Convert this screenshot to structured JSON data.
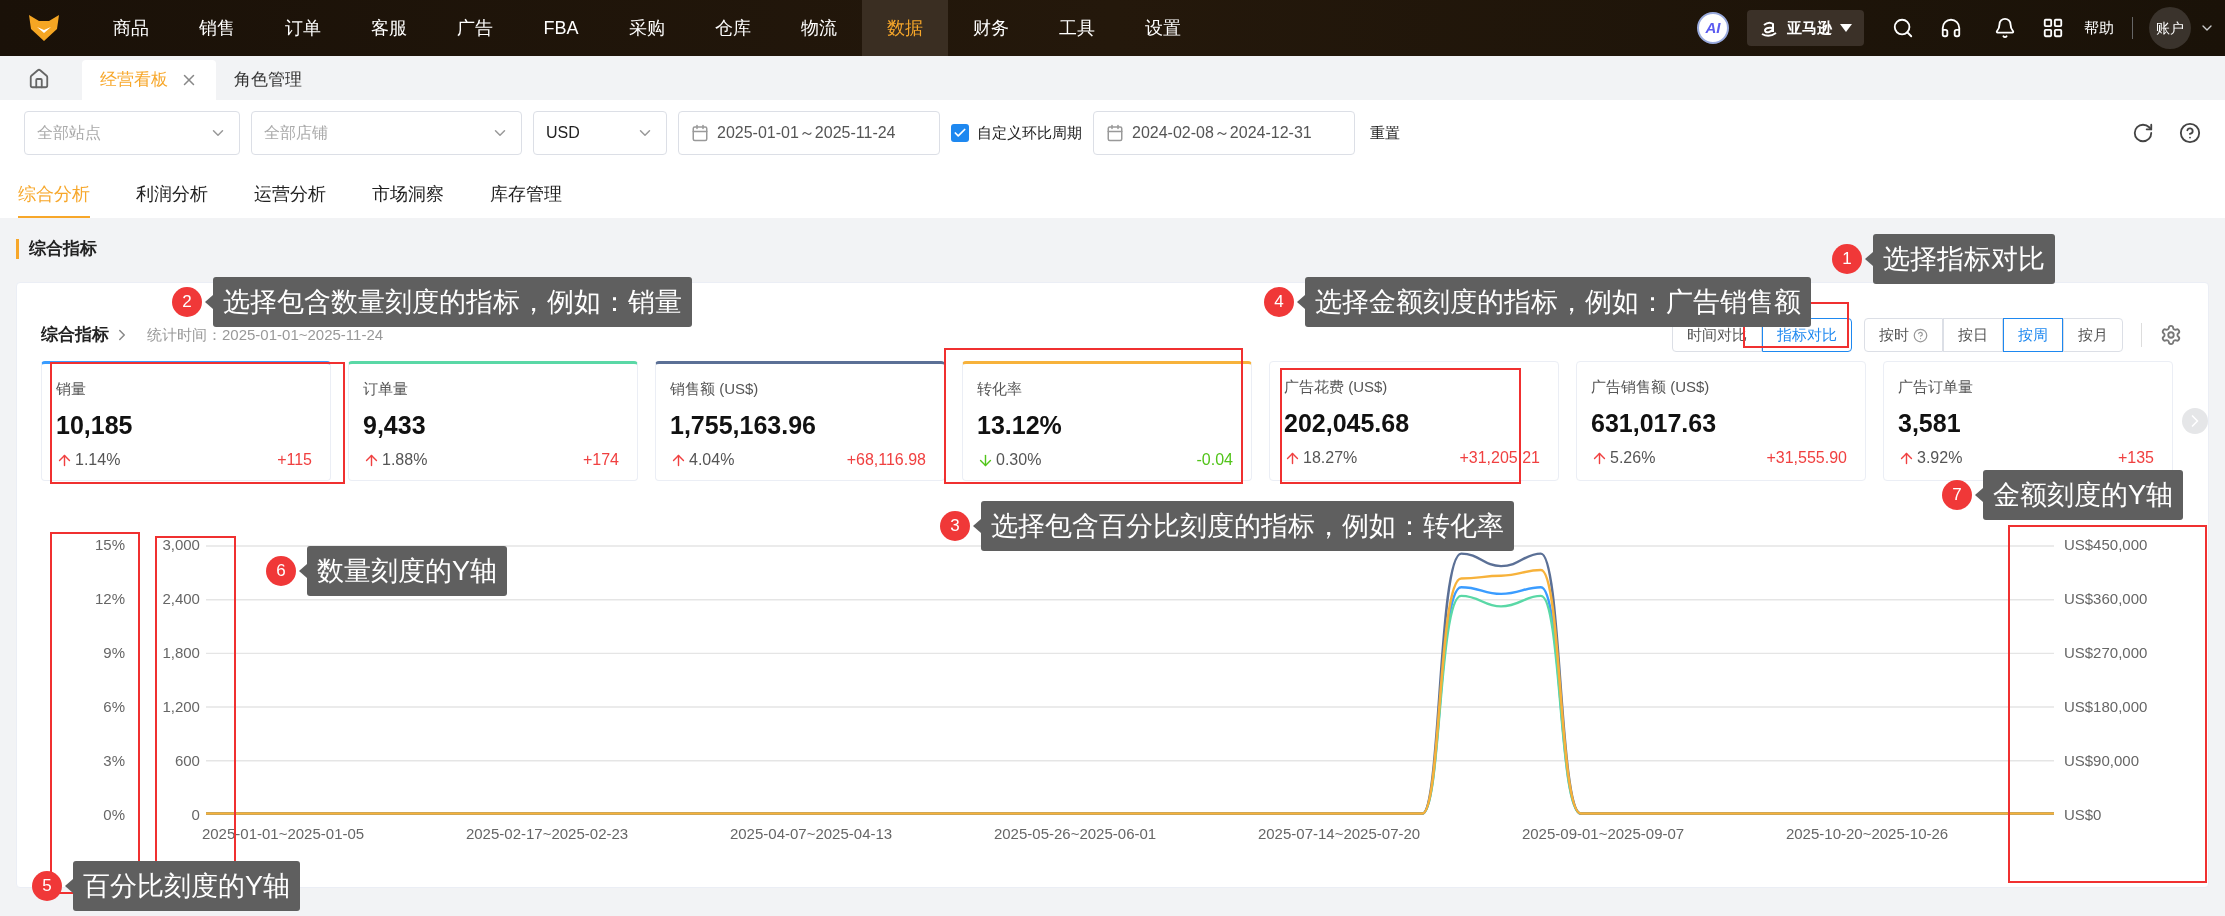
{
  "nav": {
    "items": [
      {
        "label": "商品",
        "selected": false
      },
      {
        "label": "销售",
        "selected": false
      },
      {
        "label": "订单",
        "selected": false
      },
      {
        "label": "客服",
        "selected": false
      },
      {
        "label": "广告",
        "selected": false
      },
      {
        "label": "FBA",
        "selected": false
      },
      {
        "label": "采购",
        "selected": false
      },
      {
        "label": "仓库",
        "selected": false
      },
      {
        "label": "物流",
        "selected": false
      },
      {
        "label": "数据",
        "selected": true
      },
      {
        "label": "财务",
        "selected": false
      },
      {
        "label": "工具",
        "selected": false
      },
      {
        "label": "设置",
        "selected": false
      }
    ],
    "ai_badge": "AI",
    "marketplace": "亚马逊",
    "help": "帮助",
    "account": "账户"
  },
  "page_tabs": [
    {
      "label": "经营看板",
      "selected": true,
      "closable": true
    },
    {
      "label": "角色管理",
      "selected": false,
      "closable": false
    }
  ],
  "filters": {
    "site": {
      "placeholder": "全部站点"
    },
    "shop": {
      "placeholder": "全部店铺"
    },
    "currency": {
      "value": "USD"
    },
    "date_range": "2025-01-01～2025-11-24",
    "custom_period": {
      "label": "自定义环比周期",
      "checked": true
    },
    "compare_range": "2024-02-08～2024-12-31",
    "reset": "重置"
  },
  "sub_tabs": [
    {
      "label": "综合分析",
      "selected": true
    },
    {
      "label": "利润分析",
      "selected": false
    },
    {
      "label": "运营分析",
      "selected": false
    },
    {
      "label": "市场洞察",
      "selected": false
    },
    {
      "label": "库存管理",
      "selected": false
    }
  ],
  "section_title": "综合指标",
  "panel": {
    "title": "综合指标",
    "stat_time": "统计时间：2025-01-01~2025-11-24",
    "compare_modes": [
      {
        "label": "时间对比",
        "selected": false
      },
      {
        "label": "指标对比",
        "selected": true
      }
    ],
    "granularity": [
      {
        "label": "按时",
        "selected": false,
        "help": true
      },
      {
        "label": "按日",
        "selected": false,
        "help": false
      },
      {
        "label": "按周",
        "selected": true,
        "help": false
      },
      {
        "label": "按月",
        "selected": false,
        "help": false
      }
    ],
    "cards": [
      {
        "label": "销量",
        "value": "10,185",
        "rising": true,
        "percent": "1.14%",
        "diff": "+115",
        "color": "#3a9cff"
      },
      {
        "label": "订单量",
        "value": "9,433",
        "rising": true,
        "percent": "1.88%",
        "diff": "+174",
        "color": "#5ad8a6"
      },
      {
        "label": "销售额 (US$)",
        "value": "1,755,163.96",
        "rising": true,
        "percent": "4.04%",
        "diff": "+68,116.98",
        "color": "#5b7096"
      },
      {
        "label": "转化率",
        "value": "13.12%",
        "rising": false,
        "percent": "0.30%",
        "diff": "-0.04",
        "color": "#f7b23b"
      },
      {
        "label": "广告花费 (US$)",
        "value": "202,045.68",
        "rising": true,
        "percent": "18.27%",
        "diff": "+31,205.21"
      },
      {
        "label": "广告销售额 (US$)",
        "value": "631,017.63",
        "rising": true,
        "percent": "5.26%",
        "diff": "+31,555.90"
      },
      {
        "label": "广告订单量",
        "value": "3,581",
        "rising": true,
        "percent": "3.92%",
        "diff": "+135"
      }
    ],
    "chart": {
      "percent_axis": [
        "15%",
        "12%",
        "9%",
        "6%",
        "3%",
        "0%"
      ],
      "quantity_axis": [
        "3,000",
        "2,400",
        "1,800",
        "1,200",
        "600",
        "0"
      ],
      "amount_axis": [
        "US$450,000",
        "US$360,000",
        "US$270,000",
        "US$180,000",
        "US$90,000",
        "US$0"
      ],
      "x_labels": [
        "2025-01-01~2025-01-05",
        "2025-02-17~2025-02-23",
        "2025-04-07~2025-04-13",
        "2025-05-26~2025-06-01",
        "2025-07-14~2025-07-20",
        "2025-09-01~2025-09-07",
        "2025-10-20~2025-10-26"
      ]
    }
  },
  "annotations": [
    {
      "number": "1",
      "text": "选择指标对比"
    },
    {
      "number": "2",
      "text": "选择包含数量刻度的指标，例如：销量"
    },
    {
      "number": "3",
      "text": "选择包含百分比刻度的指标，例如：转化率"
    },
    {
      "number": "4",
      "text": "选择金额刻度的指标，例如：广告销售额"
    },
    {
      "number": "5",
      "text": "百分比刻度的Y轴"
    },
    {
      "number": "6",
      "text": "数量刻度的Y轴"
    },
    {
      "number": "7",
      "text": "金额刻度的Y轴"
    }
  ]
}
